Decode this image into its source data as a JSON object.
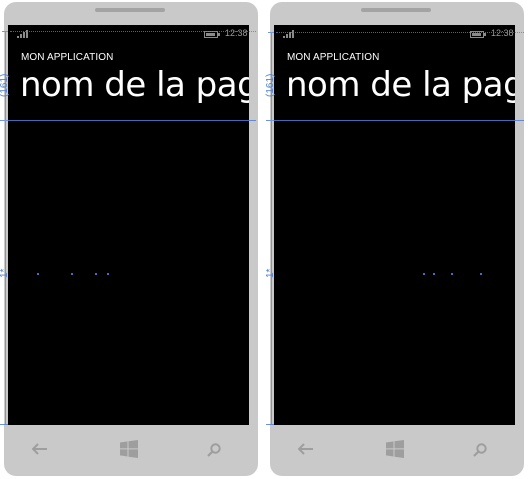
{
  "phones": [
    {
      "status": {
        "time": "12:38"
      },
      "app_title": "MON APPLICATION",
      "page_title": "nom de la page",
      "row_labels": {
        "header": "(161)",
        "content": "1*"
      }
    },
    {
      "status": {
        "time": "12:38"
      },
      "app_title": "MON APPLICATION",
      "page_title": "nom de la page",
      "row_labels": {
        "header": "(161)",
        "content": "1*"
      }
    }
  ],
  "nav": [
    "back-icon",
    "windows-start-icon",
    "search-icon"
  ],
  "colors": {
    "phone": "#c9c9c9",
    "screen": "#000000",
    "guide": "#4f7fd4",
    "nav_icon": "#9e9e9e"
  }
}
